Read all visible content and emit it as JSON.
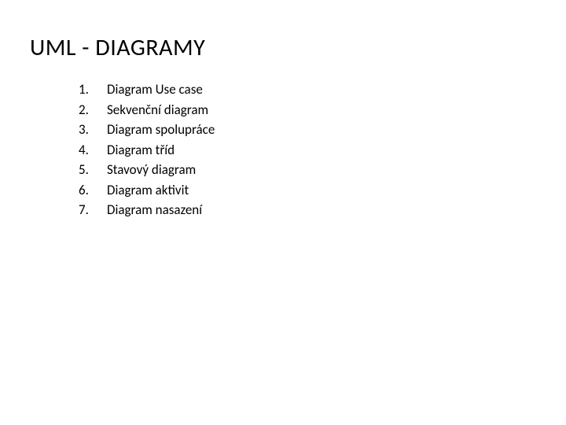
{
  "title": "UML - DIAGRAMY",
  "items": [
    {
      "n": "1.",
      "label": "Diagram Use case"
    },
    {
      "n": "2.",
      "label": "Sekvenční diagram"
    },
    {
      "n": "3.",
      "label": "Diagram spolupráce"
    },
    {
      "n": "4.",
      "label": "Diagram tříd"
    },
    {
      "n": "5.",
      "label": "Stavový diagram"
    },
    {
      "n": "6.",
      "label": "Diagram aktivit"
    },
    {
      "n": "7.",
      "label": "Diagram nasazení"
    }
  ]
}
